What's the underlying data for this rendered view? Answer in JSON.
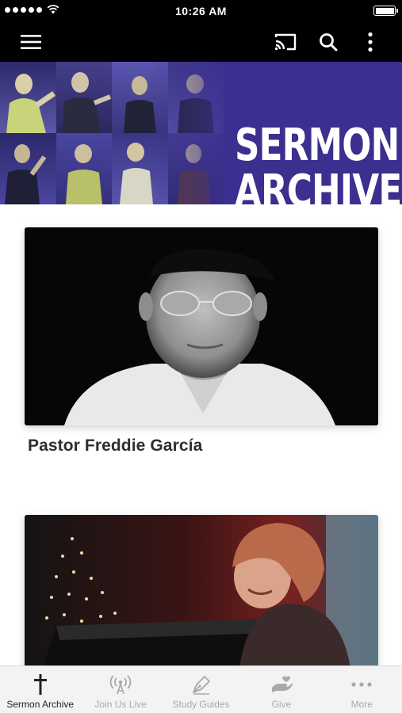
{
  "status_bar": {
    "time": "10:26 AM",
    "signal_dots": 5
  },
  "app_bar": {
    "menu_icon": "hamburger-menu-icon",
    "actions": [
      {
        "icon": "cast-icon"
      },
      {
        "icon": "search-icon"
      },
      {
        "icon": "more-vertical-icon"
      }
    ]
  },
  "banner": {
    "title_line1": "SERMON",
    "title_line2": "ARCHIVE",
    "background_color": "#3b2f8f"
  },
  "cards": [
    {
      "name": "Pastor Freddie García",
      "image": "photo of Pastor Freddie García, black and white portrait"
    },
    {
      "name": "",
      "image": "photo of a woman with red-blonde hair smiling at a pulpit in front of a Christmas tree"
    }
  ],
  "tab_bar": {
    "tabs": [
      {
        "label": "Sermon Archive",
        "icon": "cross-icon",
        "active": true
      },
      {
        "label": "Join Us Live",
        "icon": "broadcast-icon",
        "active": false
      },
      {
        "label": "Study Guides",
        "icon": "pen-nib-icon",
        "active": false
      },
      {
        "label": "Give",
        "icon": "giving-hand-icon",
        "active": false
      },
      {
        "label": "More",
        "icon": "more-horizontal-icon",
        "active": false
      }
    ]
  },
  "colors": {
    "app_bar": "#000000",
    "banner": "#3b2f8f",
    "tab_active": "#222222",
    "tab_inactive": "#a8a8a8",
    "card_title": "#2e2e2e"
  }
}
